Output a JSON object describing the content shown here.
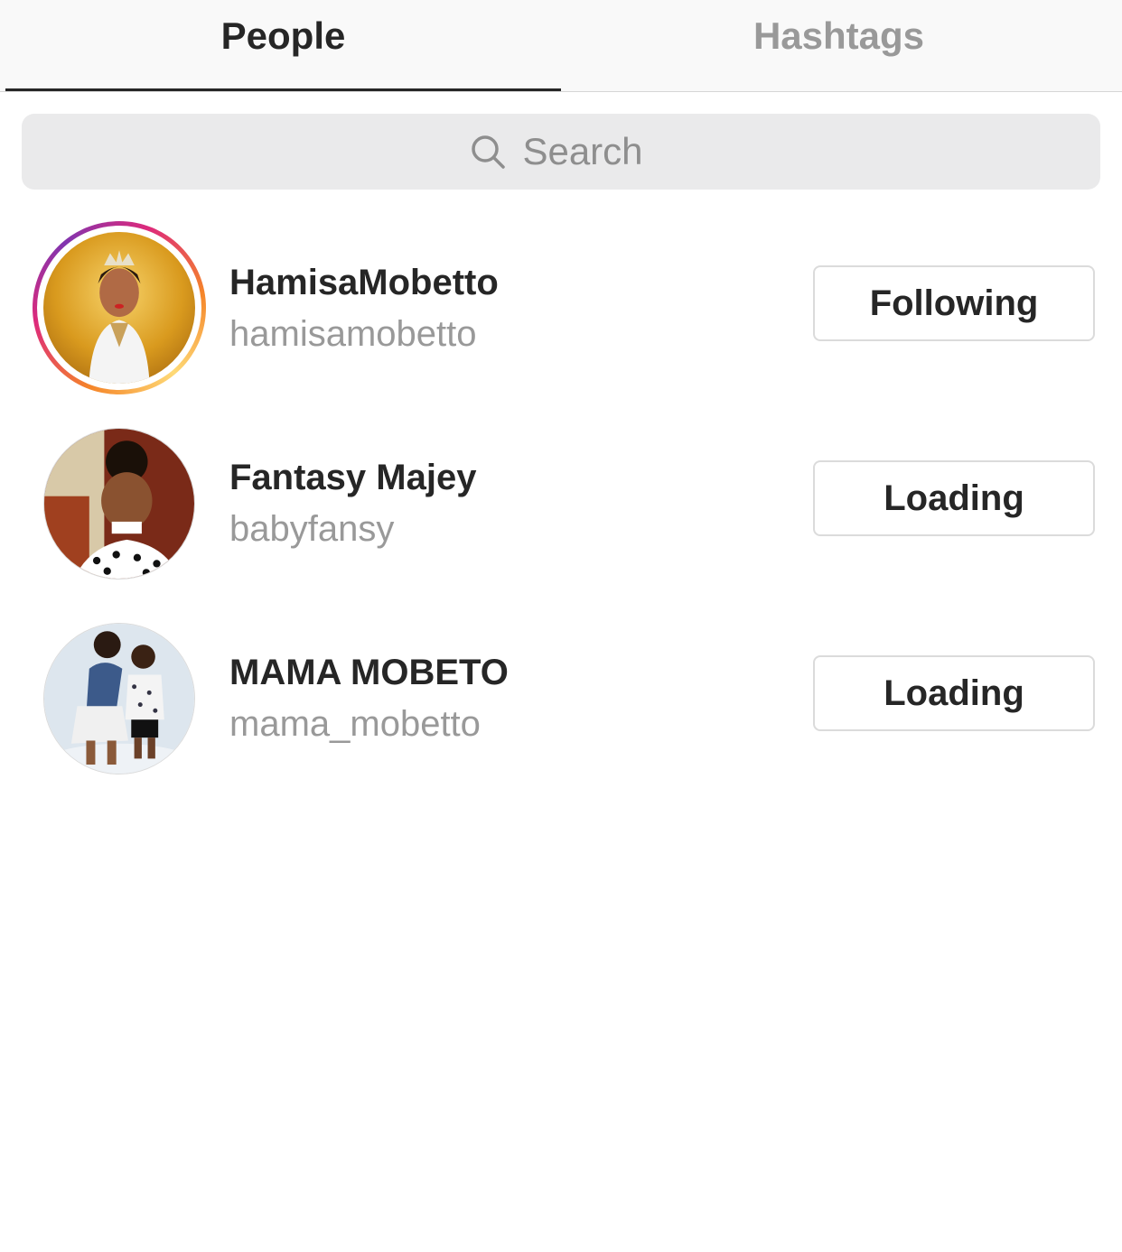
{
  "tabs": {
    "people": "People",
    "hashtags": "Hashtags",
    "active": "People"
  },
  "search": {
    "placeholder": "Search",
    "icon": "search-icon"
  },
  "results": [
    {
      "display_name": "HamisaMobetto",
      "username": "hamisamobetto",
      "button": "Following",
      "has_story_ring": true
    },
    {
      "display_name": "Fantasy Majey",
      "username": "babyfansy",
      "button": "Loading",
      "has_story_ring": false
    },
    {
      "display_name": "MAMA MOBETO",
      "username": "mama_mobetto",
      "button": "Loading",
      "has_story_ring": false
    }
  ],
  "colors": {
    "text_primary": "#262626",
    "text_secondary": "#999999",
    "button_border": "#dbdbdb",
    "search_bg": "#eaeaeb"
  }
}
